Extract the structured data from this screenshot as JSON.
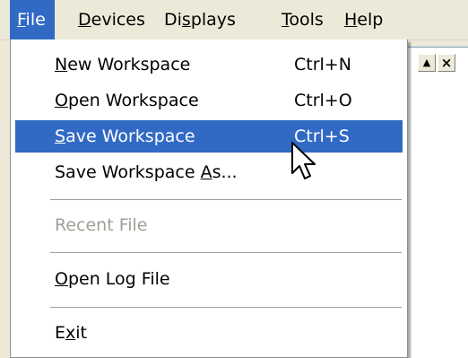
{
  "menubar": {
    "items": [
      {
        "pre": "",
        "key": "F",
        "post": "ile"
      },
      {
        "pre": "",
        "key": "D",
        "post": "evices"
      },
      {
        "pre": "Di",
        "key": "s",
        "post": "plays"
      },
      {
        "pre": "",
        "key": "T",
        "post": "ools"
      },
      {
        "pre": "",
        "key": "H",
        "post": "elp"
      }
    ]
  },
  "window_buttons": {
    "scroll_up": "▲",
    "close": "×"
  },
  "file_menu": {
    "items": [
      {
        "pre": "",
        "key": "N",
        "post": "ew Workspace",
        "shortcut": "Ctrl+N"
      },
      {
        "pre": "",
        "key": "O",
        "post": "pen Workspace",
        "shortcut": "Ctrl+O"
      },
      {
        "pre": "",
        "key": "S",
        "post": "ave Workspace",
        "shortcut": "Ctrl+S"
      },
      {
        "pre": "Save Workspace ",
        "key": "A",
        "post": "s...",
        "shortcut": ""
      },
      {
        "pre": "Recent File",
        "key": "",
        "post": "",
        "shortcut": ""
      },
      {
        "pre": "",
        "key": "O",
        "post": "pen Log File",
        "shortcut": ""
      },
      {
        "pre": "E",
        "key": "x",
        "post": "it",
        "shortcut": ""
      }
    ]
  },
  "colors": {
    "highlight": "#316ac5",
    "disabled_text": "#a19f96",
    "menubar_bg": "#ece9d8"
  },
  "icons": {
    "cursor": "arrow-cursor-icon"
  }
}
